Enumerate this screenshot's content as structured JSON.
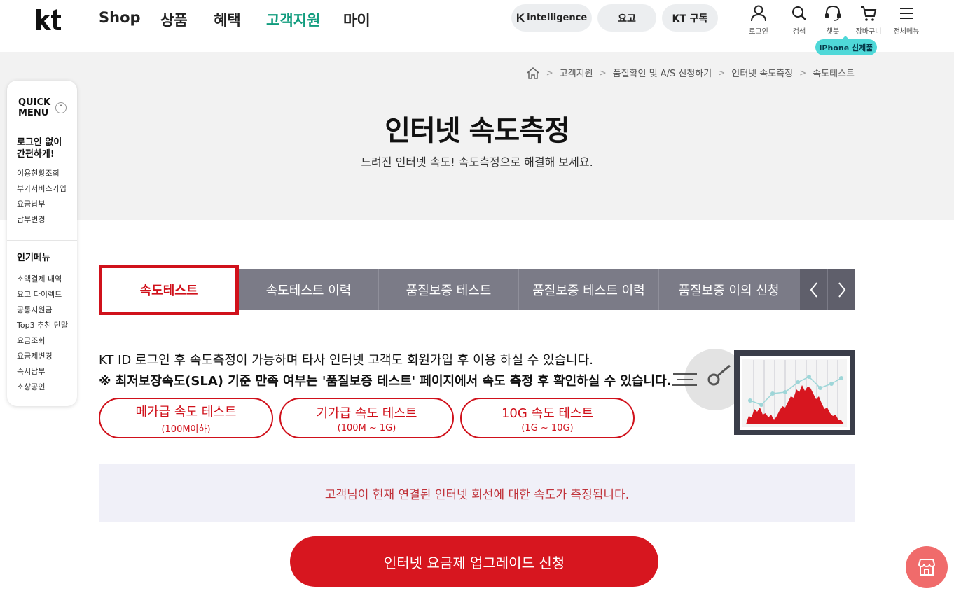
{
  "header": {
    "nav": [
      "Shop",
      "상품",
      "혜택",
      "고객지원",
      "마이"
    ],
    "pills": {
      "intelligence": "intelligence",
      "yogo": "요고",
      "kt_subscribe": "KT 구독"
    },
    "utils": {
      "login": "로그인",
      "search": "검색",
      "chatbot": "챗봇",
      "cart": "장바구니",
      "all_menu": "전체메뉴"
    },
    "tooltip": "iPhone 신제품"
  },
  "breadcrumb": [
    "고객지원",
    "품질확인 및 A/S 신청하기",
    "인터넷 속도측정",
    "속도테스트"
  ],
  "hero": {
    "title": "인터넷 속도측정",
    "subtitle": "느려진 인터넷 속도! 속도측정으로 해결해 보세요."
  },
  "quick_menu": {
    "title_line1": "QUICK",
    "title_line2": "MENU",
    "section1_title_line1": "로그인 없이",
    "section1_title_line2": "간편하게!",
    "section1_items": [
      "이용현황조회",
      "부가서비스가입",
      "요금납부",
      "납부변경"
    ],
    "section2_title": "인기메뉴",
    "section2_items": [
      "소액결제 내역",
      "요고 다이렉트",
      "공통지원금",
      "Top3 추천 단말",
      "요금조회",
      "요금제변경",
      "즉시납부",
      "소상공인"
    ]
  },
  "tabs": [
    "속도테스트",
    "속도테스트 이력",
    "품질보증 테스트",
    "품질보증 테스트 이력",
    "품질보증 이의 신청"
  ],
  "notice": {
    "line1": "KT ID 로그인 후 속도측정이 가능하며 타사 인터넷 고객도 회원가입 후 이용 하실 수 있습니다.",
    "line2": "※ 최저보장속도(SLA) 기준 만족 여부는 '품질보증 테스트' 페이지에서 속도 측정 후 확인하실 수 있습니다."
  },
  "test_buttons": [
    {
      "title": "메가급 속도 테스트",
      "range": "(100M이하)"
    },
    {
      "title": "기가급 속도 테스트",
      "range": "(100M ~ 1G)"
    },
    {
      "title": "10G 속도 테스트",
      "range": "(1G ~ 10G)"
    }
  ],
  "info_text": "고객님이 현재 연결된 인터넷 회선에 대한 속도가 측정됩니다.",
  "cta_label": "인터넷 요금제 업그레이드 신청",
  "colors": {
    "brand_red": "#d0111b",
    "active_nav": "#119c7e",
    "tab_bg": "#7b7b87",
    "tooltip_bg": "#4fd8d8"
  }
}
